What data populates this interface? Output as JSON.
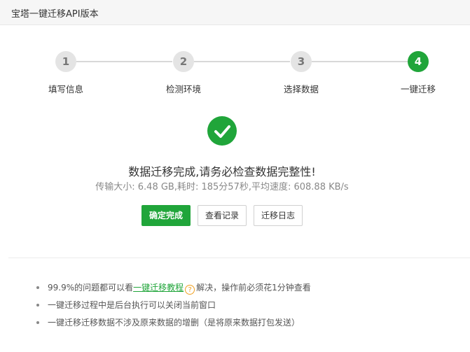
{
  "window": {
    "title": "宝塔一键迁移API版本"
  },
  "steps": [
    {
      "number": "1",
      "label": "填写信息"
    },
    {
      "number": "2",
      "label": "检测环境"
    },
    {
      "number": "3",
      "label": "选择数据"
    },
    {
      "number": "4",
      "label": "一键迁移"
    }
  ],
  "result": {
    "message": "数据迁移完成,请务必检查数据完整性!",
    "stats": "传输大小: 6.48 GB,耗时: 185分57秒,平均速度: 608.88 KB/s"
  },
  "buttons": {
    "confirm": "确定完成",
    "records": "查看记录",
    "log": "迁移日志"
  },
  "notes": {
    "note1_prefix": "99.9%的问题都可以看",
    "note1_link": "一键迁移教程",
    "note1_help": "?",
    "note1_suffix": "解决，操作前必须花1分钟查看",
    "note2": "一键迁移过程中是后台执行可以关闭当前窗口",
    "note3": "一键迁移迁移数据不涉及原来数据的增删（是将原来数据打包发送）"
  },
  "colors": {
    "accent": "#20a53a",
    "inactive_step": "#e4e4e4",
    "help": "#f0a020"
  }
}
